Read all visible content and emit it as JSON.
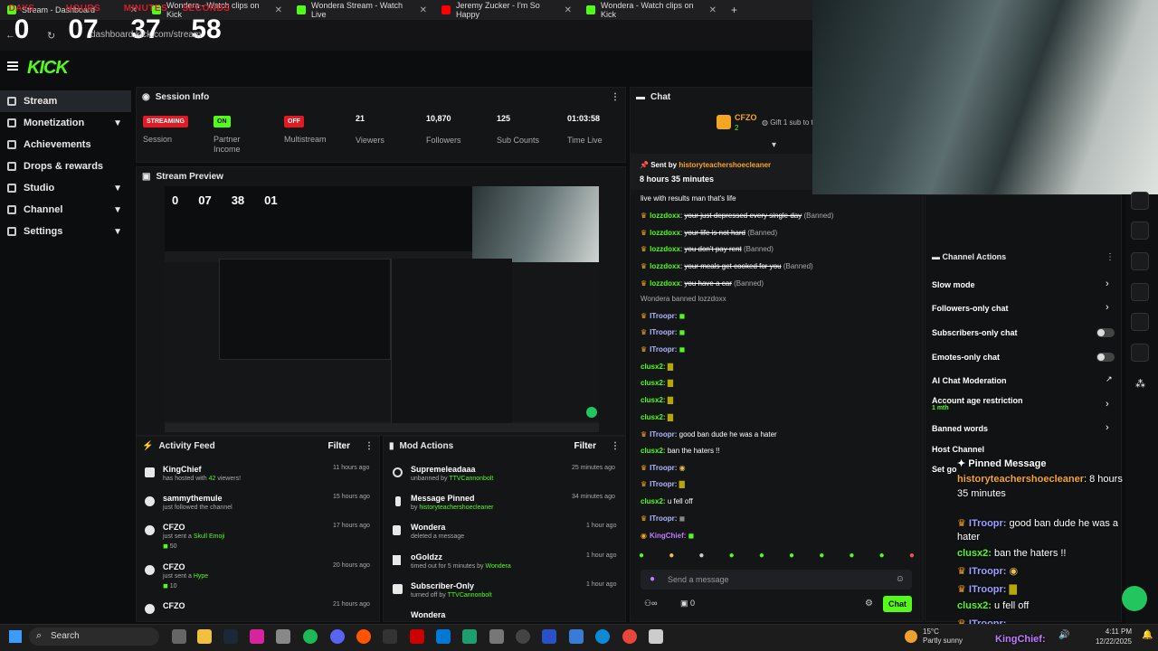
{
  "browser": {
    "tabs": [
      {
        "label": "Stream - Dashboard"
      },
      {
        "label": "Wondera - Watch clips on Kick"
      },
      {
        "label": "Wondera Stream - Watch Live"
      },
      {
        "label": "Jeremy Zucker - I'm So Happy"
      },
      {
        "label": "Wondera - Watch clips on Kick"
      }
    ],
    "url": "dashboard.kick.com/stream"
  },
  "timer": {
    "labels": [
      "DAYS",
      "HOURS",
      "MINUTES",
      "SECONDS"
    ],
    "values": [
      "0",
      "07",
      "37",
      "58"
    ]
  },
  "brand": {
    "logo": "KICK",
    "color": "#53fc18"
  },
  "sidebar": {
    "items": [
      {
        "label": "Stream"
      },
      {
        "label": "Monetization"
      },
      {
        "label": "Achievements"
      },
      {
        "label": "Drops & rewards"
      },
      {
        "label": "Studio"
      },
      {
        "label": "Channel"
      },
      {
        "label": "Settings"
      }
    ]
  },
  "session": {
    "title": "Session Info",
    "stream_badge": "STREAMING",
    "stream_label": "Session",
    "partner_badge": "ON",
    "partner_label": "Partner Income",
    "multi_badge": "OFF",
    "multi_label": "Multistream",
    "viewers": "21",
    "viewers_label": "Viewers",
    "followers": "10,870",
    "followers_label": "Followers",
    "subs": "125",
    "subs_label": "Sub Counts",
    "time": "01:03:58",
    "time_label": "Time Live"
  },
  "preview": {
    "title": "Stream Preview",
    "timer": [
      "0",
      "07",
      "38",
      "01"
    ]
  },
  "activity": {
    "title": "Activity Feed",
    "filter": "Filter",
    "items": [
      {
        "name": "KingChief",
        "pre": "has hosted with ",
        "hl": "42",
        "post": " viewers!",
        "time": "11 hours ago"
      },
      {
        "name": "sammythemule",
        "pre": "just followed the channel",
        "hl": "",
        "post": "",
        "time": "15 hours ago"
      },
      {
        "name": "CFZO",
        "pre": "just sent a ",
        "hl": "Skull Emoji",
        "post": "",
        "time": "17 hours ago",
        "amount": "50"
      },
      {
        "name": "CFZO",
        "pre": "just sent a ",
        "hl": "Hype",
        "post": "",
        "time": "20 hours ago",
        "amount": "10"
      },
      {
        "name": "CFZO",
        "pre": "",
        "hl": "",
        "post": "",
        "time": "21 hours ago"
      }
    ]
  },
  "mod": {
    "title": "Mod Actions",
    "filter": "Filter",
    "items": [
      {
        "name": "Supremeleadaaa",
        "pre": "unbanned by ",
        "hl": "TTVCannonbolt",
        "time": "25 minutes ago"
      },
      {
        "name": "Message Pinned",
        "pre": "by ",
        "hl": "historyteachershoecleaner",
        "time": "34 minutes ago"
      },
      {
        "name": "Wondera",
        "pre": "deleted a message",
        "hl": "",
        "time": "1 hour ago"
      },
      {
        "name": "oGoldzz",
        "pre": "timed out for 5 minutes by ",
        "hl": "Wondera",
        "time": "1 hour ago"
      },
      {
        "name": "Subscriber-Only",
        "pre": "turned off by ",
        "hl": "TTVCannonbolt",
        "time": "1 hour ago"
      },
      {
        "name": "Wondera",
        "pre": "",
        "hl": "",
        "time": ""
      }
    ]
  },
  "chat": {
    "title": "Chat",
    "top_gifter": "CFZO",
    "top_gifter_count": "2",
    "gift_text": "Gift 1 sub to t",
    "sent_by_label": "Sent by",
    "pinned_user": "historyteachershoecleaner",
    "pinned_time": "8 hours 35 minutes",
    "fragment": "live with results man that's life",
    "messages": [
      {
        "user": "lozzdoxx",
        "text": "your just depressed every single day",
        "note": "(Banned)",
        "color": "#53fc18"
      },
      {
        "user": "lozzdoxx",
        "text": "your life is not hard",
        "note": "(Banned)",
        "color": "#53fc18"
      },
      {
        "user": "lozzdoxx",
        "text": "you don't pay rent",
        "note": "(Banned)",
        "color": "#53fc18"
      },
      {
        "user": "lozzdoxx",
        "text": "your meals get cooked for you",
        "note": "(Banned)",
        "color": "#53fc18"
      },
      {
        "user": "lozzdoxx",
        "text": "you have a car",
        "note": "(Banned)",
        "color": "#53fc18"
      }
    ],
    "ban_notice": "Wondera banned lozzdoxx",
    "lines": [
      {
        "user": "ITroopr:",
        "text": "",
        "color": "#b4b8ff"
      },
      {
        "user": "ITroopr:",
        "text": "",
        "color": "#b4b8ff"
      },
      {
        "user": "ITroopr:",
        "text": "",
        "color": "#b4b8ff"
      },
      {
        "user": "clusx2:",
        "text": "",
        "color": "#53fc18"
      },
      {
        "user": "clusx2:",
        "text": "",
        "color": "#53fc18"
      },
      {
        "user": "clusx2:",
        "text": "",
        "color": "#53fc18"
      },
      {
        "user": "clusx2:",
        "text": "",
        "color": "#53fc18"
      },
      {
        "user": "ITroopr:",
        "text": "good ban dude he was a hater",
        "color": "#b4b8ff"
      },
      {
        "user": "clusx2:",
        "text": "ban the haters !!",
        "color": "#53fc18"
      },
      {
        "user": "ITroopr:",
        "text": "",
        "color": "#b4b8ff"
      },
      {
        "user": "ITroopr:",
        "text": "",
        "color": "#b4b8ff"
      },
      {
        "user": "clusx2:",
        "text": "u fell off",
        "color": "#53fc18"
      },
      {
        "user": "ITroopr:",
        "text": "",
        "color": "#b4b8ff"
      },
      {
        "user": "KingChief:",
        "text": "",
        "color": "#c07cff"
      }
    ],
    "input_placeholder": "Send a message",
    "viewer_count": "0",
    "send_label": "Chat"
  },
  "channel_actions": {
    "title": "Channel Actions",
    "items": [
      {
        "label": "Slow mode",
        "kind": "arrow"
      },
      {
        "label": "Followers-only chat",
        "kind": "arrow"
      },
      {
        "label": "Subscribers-only chat",
        "kind": "toggle"
      },
      {
        "label": "Emotes-only chat",
        "kind": "toggle"
      },
      {
        "label": "AI Chat Moderation",
        "kind": "external"
      },
      {
        "label": "Account age restriction",
        "kind": "arrow",
        "sub": "1 mth"
      },
      {
        "label": "Banned words",
        "kind": "arrow"
      },
      {
        "label": "Host Channel",
        "kind": "none"
      },
      {
        "label": "Set go",
        "kind": "none"
      }
    ]
  },
  "overlay": {
    "pinned_title": "Pinned Message",
    "pinned_user": "historyteachershoecleaner",
    "pinned_time": ": 8 hours",
    "pinned_time2": "35 minutes",
    "lines": [
      {
        "user": "ITroopr:",
        "text": "good ban dude he was a",
        "text2": "hater"
      },
      {
        "user": "clusx2:",
        "text": "ban the haters !!"
      },
      {
        "user": "ITroopr:",
        "text": ""
      },
      {
        "user": "ITroopr:",
        "text": ""
      },
      {
        "user": "clusx2:",
        "text": "u fell off"
      },
      {
        "user": "ITroopr:",
        "text": ""
      },
      {
        "user": "KingChief:",
        "text": ""
      }
    ]
  },
  "taskbar": {
    "search": "Search",
    "weather_temp": "15°C",
    "weather_desc": "Partly sunny",
    "time": "4:11 PM",
    "date": "12/22/2025"
  }
}
